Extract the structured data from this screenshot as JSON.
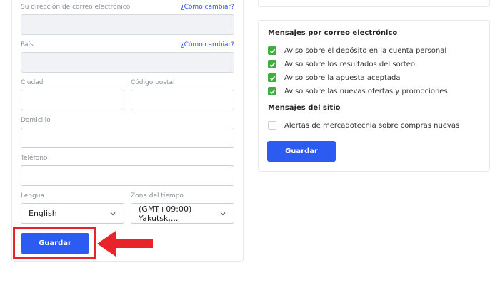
{
  "left_form": {
    "email": {
      "label": "Su dirección de correo electrónico",
      "change_link": "¿Cómo cambiar?",
      "value": ""
    },
    "country": {
      "label": "País",
      "change_link": "¿Cómo cambiar?",
      "value": ""
    },
    "city": {
      "label": "Ciudad",
      "value": ""
    },
    "postal_code": {
      "label": "Código postal",
      "value": ""
    },
    "address": {
      "label": "Domicilio",
      "value": ""
    },
    "phone": {
      "label": "Teléfono",
      "value": ""
    },
    "language": {
      "label": "Lengua",
      "selected": "English"
    },
    "timezone": {
      "label": "Zona del tiempo",
      "selected": "(GMT+09:00) Yakutsk,..."
    },
    "save_label": "Guardar"
  },
  "right_panel": {
    "email_section_title": "Mensajes por correo electrónico",
    "email_options": [
      {
        "label": "Aviso sobre el depósito en la cuenta personal",
        "checked": true
      },
      {
        "label": "Aviso sobre los resultados del sorteo",
        "checked": true
      },
      {
        "label": "Aviso sobre la apuesta aceptada",
        "checked": true
      },
      {
        "label": "Aviso sobre las nuevas ofertas y promociones",
        "checked": true
      }
    ],
    "site_section_title": "Mensajes del sitio",
    "site_options": [
      {
        "label": "Alertas de mercadotecnia sobre compras nuevas",
        "checked": false
      }
    ],
    "save_label": "Guardar"
  },
  "colors": {
    "primary": "#2b5bf0",
    "link": "#2b57e0",
    "check_green": "#3fae3f",
    "highlight_red": "#e8242a"
  }
}
